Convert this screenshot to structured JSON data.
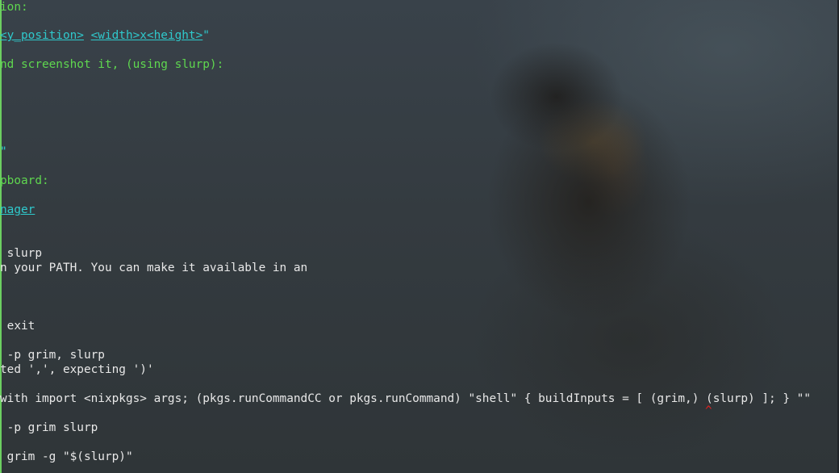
{
  "terminal": {
    "lines": {
      "l1": "ion:",
      "l2_pre": "",
      "l2_link1": "<y_position>",
      "l2_space": " ",
      "l2_link2": "<width>x<height>",
      "l2_quote": "\"",
      "l3": "nd screenshot it, (using slurp):",
      "l4_link": "",
      "l4_quote": "\"",
      "l5": "pboard:",
      "l6_link": "nager",
      "l7": " slurp",
      "l8": "n your PATH. You can make it available in an",
      "l9": " exit",
      "l10": " -p grim, slurp",
      "l11": "ted ',', expecting ')'",
      "l12": "with import <nixpkgs> args; (pkgs.runCommandCC or pkgs.runCommand) \"shell\" { buildInputs = [ (grim,) (slurp) ]; } \"\"",
      "l13": "^",
      "l14": " -p grim slurp",
      "l15": " grim -g \"$(slurp)\""
    }
  },
  "colors": {
    "green_text": "#5fd74f",
    "cyan_link": "#2fc9cc",
    "white_text": "#e8e8e8",
    "error_caret": "#e02020"
  }
}
